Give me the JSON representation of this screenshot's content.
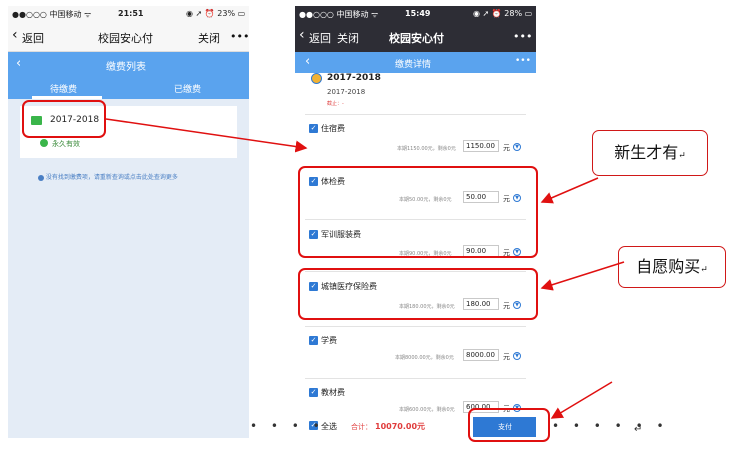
{
  "left_phone": {
    "status": {
      "carrier": "●●○○○ 中国移动 ᯤ",
      "time": "21:51",
      "battery": "◉ ➚ ⏰ 23% ▭"
    },
    "nav": {
      "back_label": "返回",
      "title": "校园安心付",
      "close_label": "关闭",
      "more_label": "•••"
    },
    "subnav_title": "缴费列表",
    "tabs": [
      {
        "label": "待缴费"
      },
      {
        "label": "已缴费"
      }
    ],
    "card": {
      "year": "2017-2018",
      "validity": "永久有效"
    },
    "hint": "没有找到缴费项，请重新查询或点击此处查询更多"
  },
  "right_phone": {
    "status": {
      "carrier": "●●○○○ 中国移动 ᯤ",
      "time": "15:49",
      "battery": "◉ ➚ ⏰ 28% ▭"
    },
    "nav": {
      "back_label": "返回",
      "close_label": "关闭",
      "title": "校园安心付",
      "more_label": "•••"
    },
    "subnav_title": "缴费详情",
    "subnav_more": "•••",
    "header": {
      "year": "2017-2018",
      "year_sub": "2017-2018",
      "status_prefix": "截止：",
      "status_value": "-"
    },
    "items": [
      {
        "name": "住宿费",
        "note": "本期1150.00元，剩余0元",
        "amount": "1150.00",
        "unit": "元"
      },
      {
        "name": "体检费",
        "note": "本期50.00元，剩余0元",
        "amount": "50.00",
        "unit": "元"
      },
      {
        "name": "军训服装费",
        "note": "本期90.00元，剩余0元",
        "amount": "90.00",
        "unit": "元"
      },
      {
        "name": "城镇医疗保险费",
        "note": "本期180.00元，剩余0元",
        "amount": "180.00",
        "unit": "元"
      },
      {
        "name": "学费",
        "note": "本期8000.00元，剩余0元",
        "amount": "8000.00",
        "unit": "元"
      },
      {
        "name": "教材费",
        "note": "本期600.00元，剩余0元",
        "amount": "600.00",
        "unit": "元"
      }
    ],
    "footer": {
      "select_all": "全选",
      "total_label": "合计：",
      "total_value": "10070.00元",
      "pay_label": "支付"
    }
  },
  "annotations": {
    "new_students_only": "新生才有",
    "voluntary": "自愿购买",
    "return_mark": "↵",
    "accent_color": "#e01010"
  }
}
